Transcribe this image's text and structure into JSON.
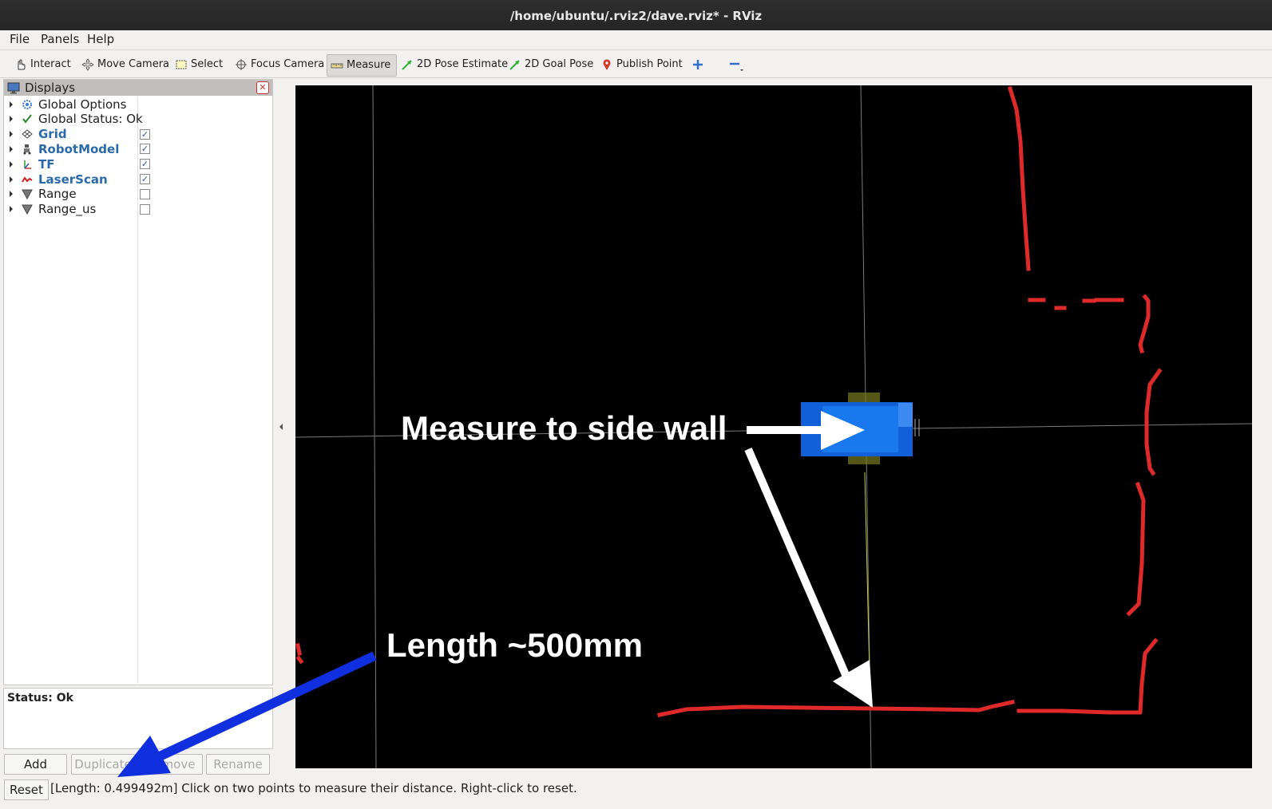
{
  "window": {
    "title": "/home/ubuntu/.rviz2/dave.rviz* - RViz"
  },
  "menu": {
    "file": "File",
    "panels": "Panels",
    "help": "Help"
  },
  "toolbar": {
    "interact": "Interact",
    "move_camera": "Move Camera",
    "select": "Select",
    "focus_camera": "Focus Camera",
    "measure": "Measure",
    "pose_estimate": "2D Pose Estimate",
    "goal_pose": "2D Goal Pose",
    "publish_point": "Publish Point",
    "active_tool": "Measure"
  },
  "displays": {
    "title": "Displays",
    "items": [
      {
        "label": "Global Options",
        "icon": "gear-icon",
        "checkable": false,
        "checked": false,
        "highlight": false
      },
      {
        "label": "Global Status: Ok",
        "icon": "check-icon",
        "checkable": false,
        "checked": false,
        "highlight": false
      },
      {
        "label": "Grid",
        "icon": "grid-icon",
        "checkable": true,
        "checked": true,
        "highlight": true
      },
      {
        "label": "RobotModel",
        "icon": "robot-icon",
        "checkable": true,
        "checked": true,
        "highlight": true
      },
      {
        "label": "TF",
        "icon": "axes-icon",
        "checkable": true,
        "checked": true,
        "highlight": true
      },
      {
        "label": "LaserScan",
        "icon": "laser-icon",
        "checkable": true,
        "checked": true,
        "highlight": true
      },
      {
        "label": "Range",
        "icon": "cone-icon",
        "checkable": true,
        "checked": false,
        "highlight": false
      },
      {
        "label": "Range_us",
        "icon": "cone-icon",
        "checkable": true,
        "checked": false,
        "highlight": false
      }
    ],
    "status": "Status: Ok"
  },
  "buttons": {
    "add": "Add",
    "duplicate": "Duplicate",
    "remove": "Remove",
    "rename": "Rename"
  },
  "statusbar": {
    "reset": "Reset",
    "message": "[Length: 0.499492m] Click on two points to measure their distance. Right-click to reset."
  },
  "annotations": {
    "measure_label": "Measure to side wall",
    "length_label": "Length ~500mm"
  },
  "colors": {
    "laser": "#e02a2a",
    "robot": "#1a6fe0",
    "arrow_blue": "#1030e0",
    "background": "#000000"
  }
}
